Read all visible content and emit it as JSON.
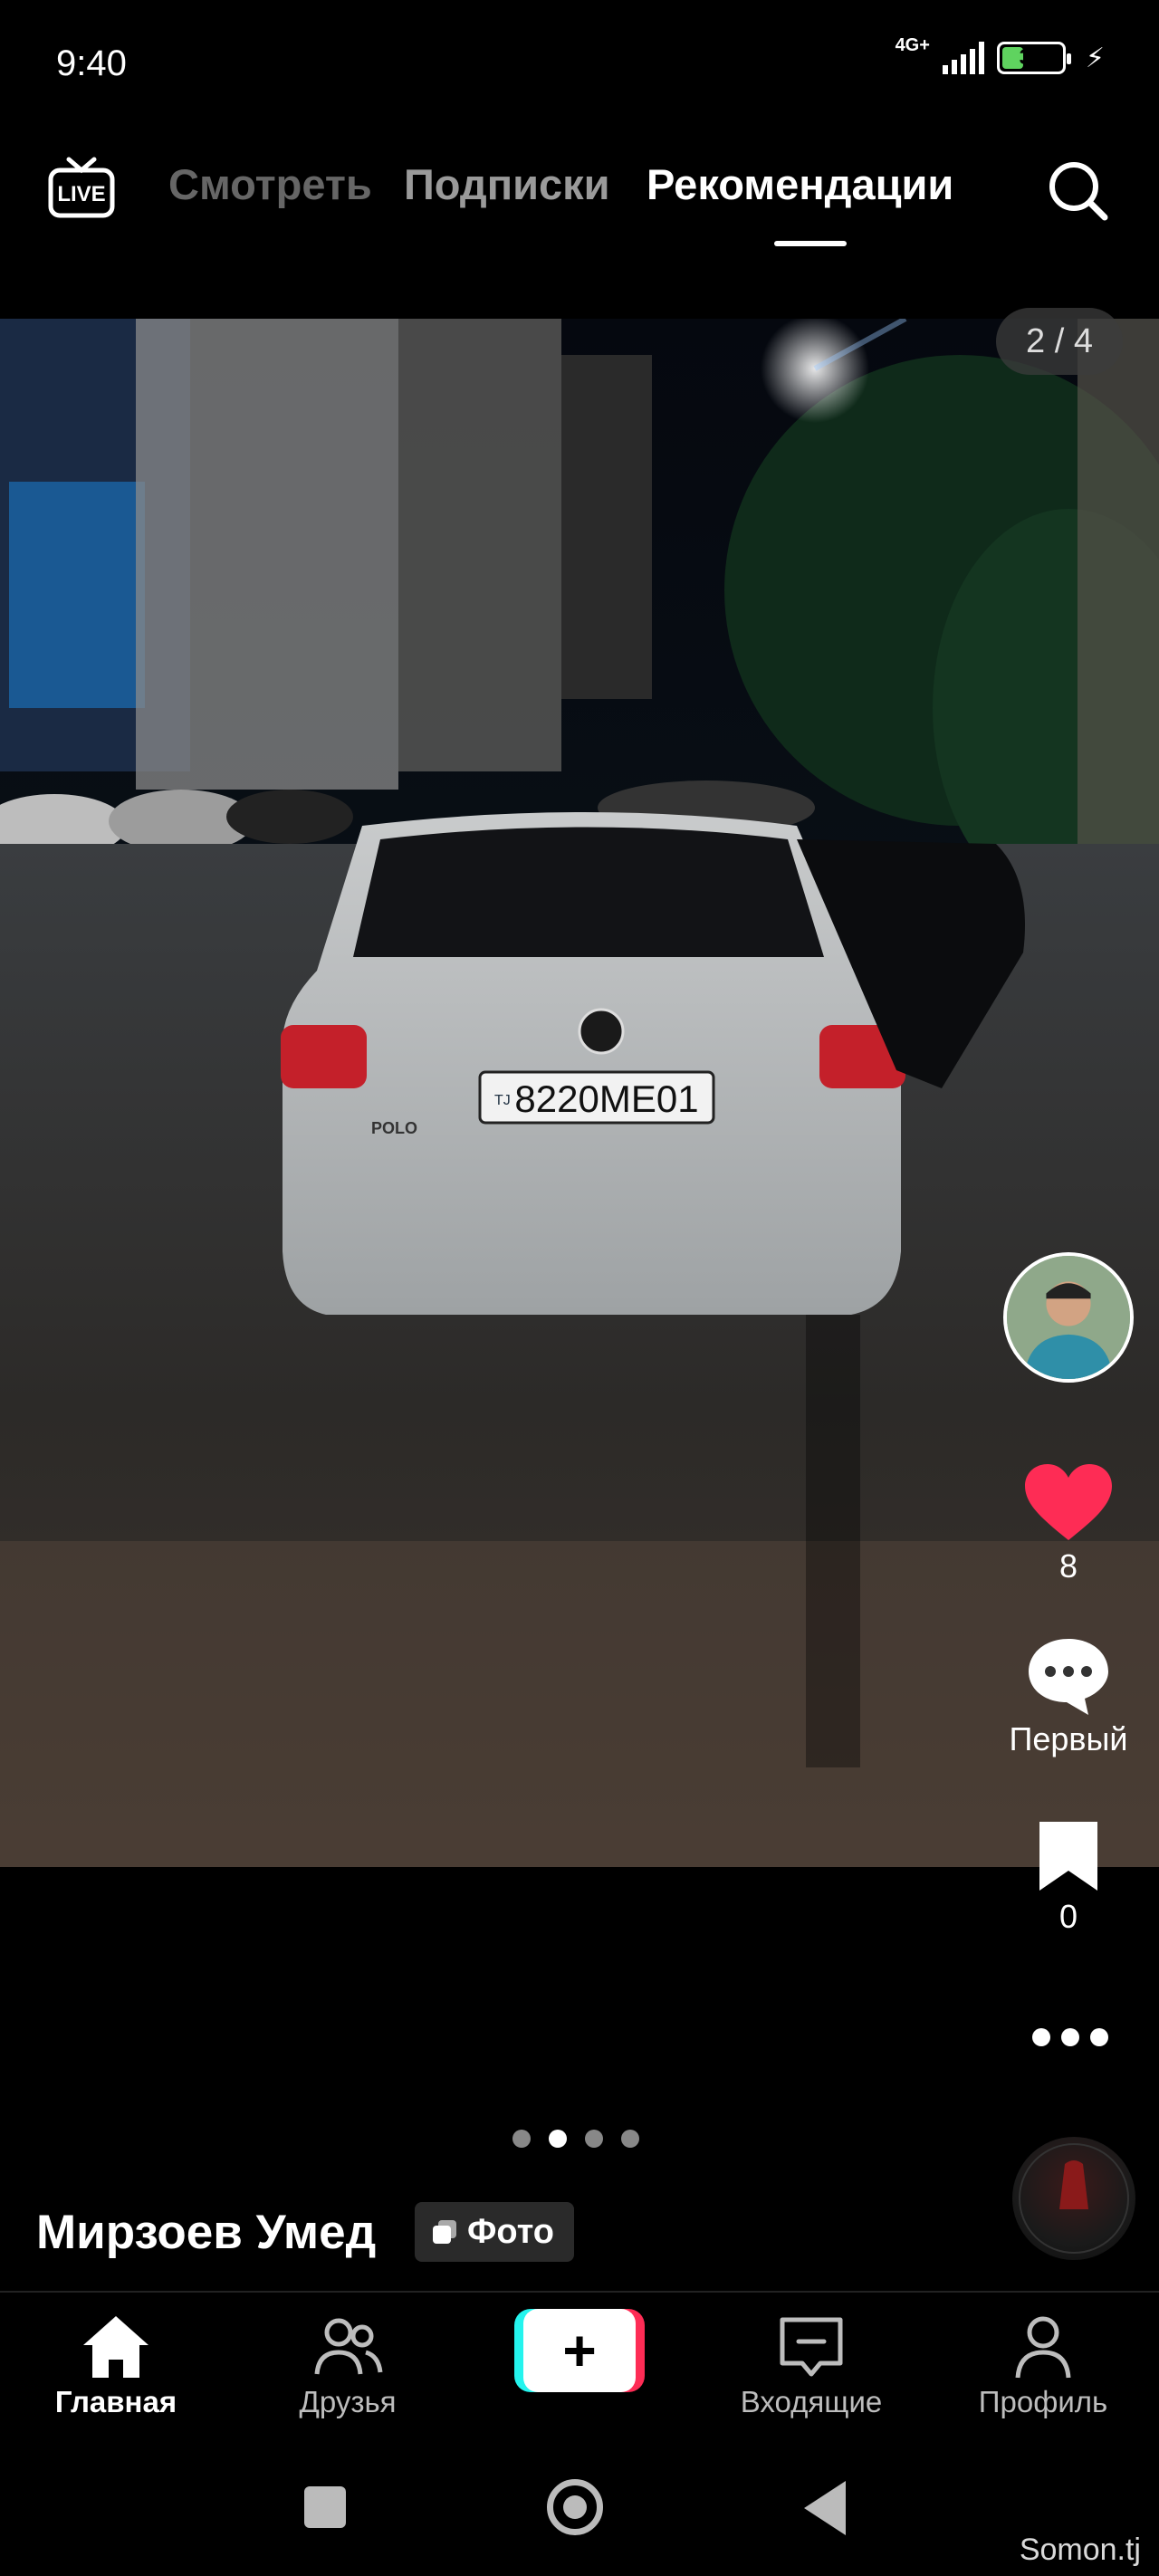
{
  "status_bar": {
    "time": "9:40",
    "network": "4G+",
    "battery": "36",
    "battery_level": 0.36
  },
  "top_nav": {
    "live_label": "LIVE",
    "tabs": [
      {
        "label": "Смотреть"
      },
      {
        "label": "Подписки"
      },
      {
        "label": "Рекомендации",
        "active": true
      }
    ]
  },
  "post": {
    "page_indicator": "2 / 4",
    "plate_text": "8220ME01",
    "plate_country": "TJ",
    "car_badge": "POLO",
    "carousel_total": 4,
    "carousel_active": 2,
    "author": "Мирзоев Умед",
    "badge_label": "Фото"
  },
  "actions": {
    "likes": "8",
    "comments": "Первый",
    "saves": "0"
  },
  "bottom_nav": {
    "home": "Главная",
    "friends": "Друзья",
    "create": "+",
    "inbox": "Входящие",
    "profile": "Профиль"
  },
  "watermark": "Somon.tj",
  "colors": {
    "like": "#fe2c55",
    "create_left": "#25f4ee",
    "create_right": "#fe2c55",
    "battery": "#5fd35f"
  },
  "icons": [
    "live-icon",
    "search-icon",
    "heart-icon",
    "comment-icon",
    "bookmark-icon",
    "more-icon",
    "home-icon",
    "friends-icon",
    "plus-icon",
    "inbox-icon",
    "profile-icon"
  ]
}
